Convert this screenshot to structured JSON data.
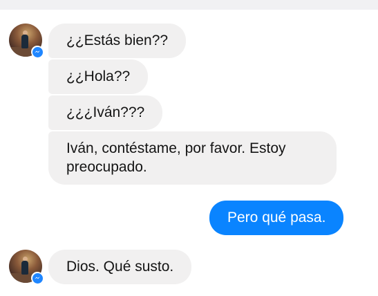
{
  "thread": {
    "incoming_group_1": [
      "¿¿Estás bien??",
      "¿¿Hola??",
      "¿¿¿Iván???",
      "Iván, contéstame, por favor. Estoy preocupado."
    ],
    "outgoing": [
      "Pero qué pasa."
    ],
    "incoming_group_2": [
      "Dios. Qué susto."
    ]
  },
  "colors": {
    "incoming_bubble": "#f1f0f0",
    "outgoing_bubble": "#0a84ff",
    "messenger_badge": "#1f86ff"
  },
  "icons": {
    "badge": "messenger-icon"
  }
}
